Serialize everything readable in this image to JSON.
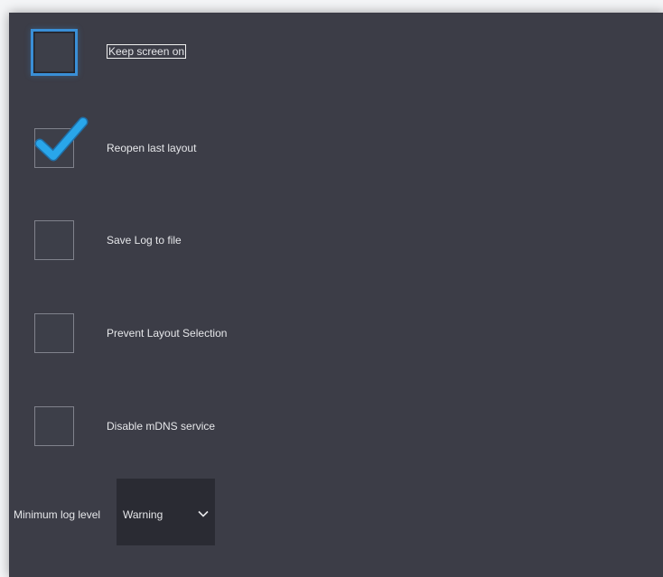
{
  "settings": {
    "options": [
      {
        "label": "Keep screen on",
        "checked": false,
        "focused": true
      },
      {
        "label": "Reopen last layout",
        "checked": true,
        "focused": false
      },
      {
        "label": "Save Log to file",
        "checked": false,
        "focused": false
      },
      {
        "label": "Prevent Layout Selection",
        "checked": false,
        "focused": false
      },
      {
        "label": "Disable mDNS service",
        "checked": false,
        "focused": false
      }
    ],
    "log_level": {
      "label": "Minimum log level",
      "value": "Warning",
      "icon": "chevron-down-icon"
    }
  },
  "colors": {
    "panel_bg": "#3c3d47",
    "accent": "#3a8fd6",
    "checkmark": "#29a6ea",
    "text": "#e6e7ea",
    "select_bg": "#2a2b33"
  }
}
